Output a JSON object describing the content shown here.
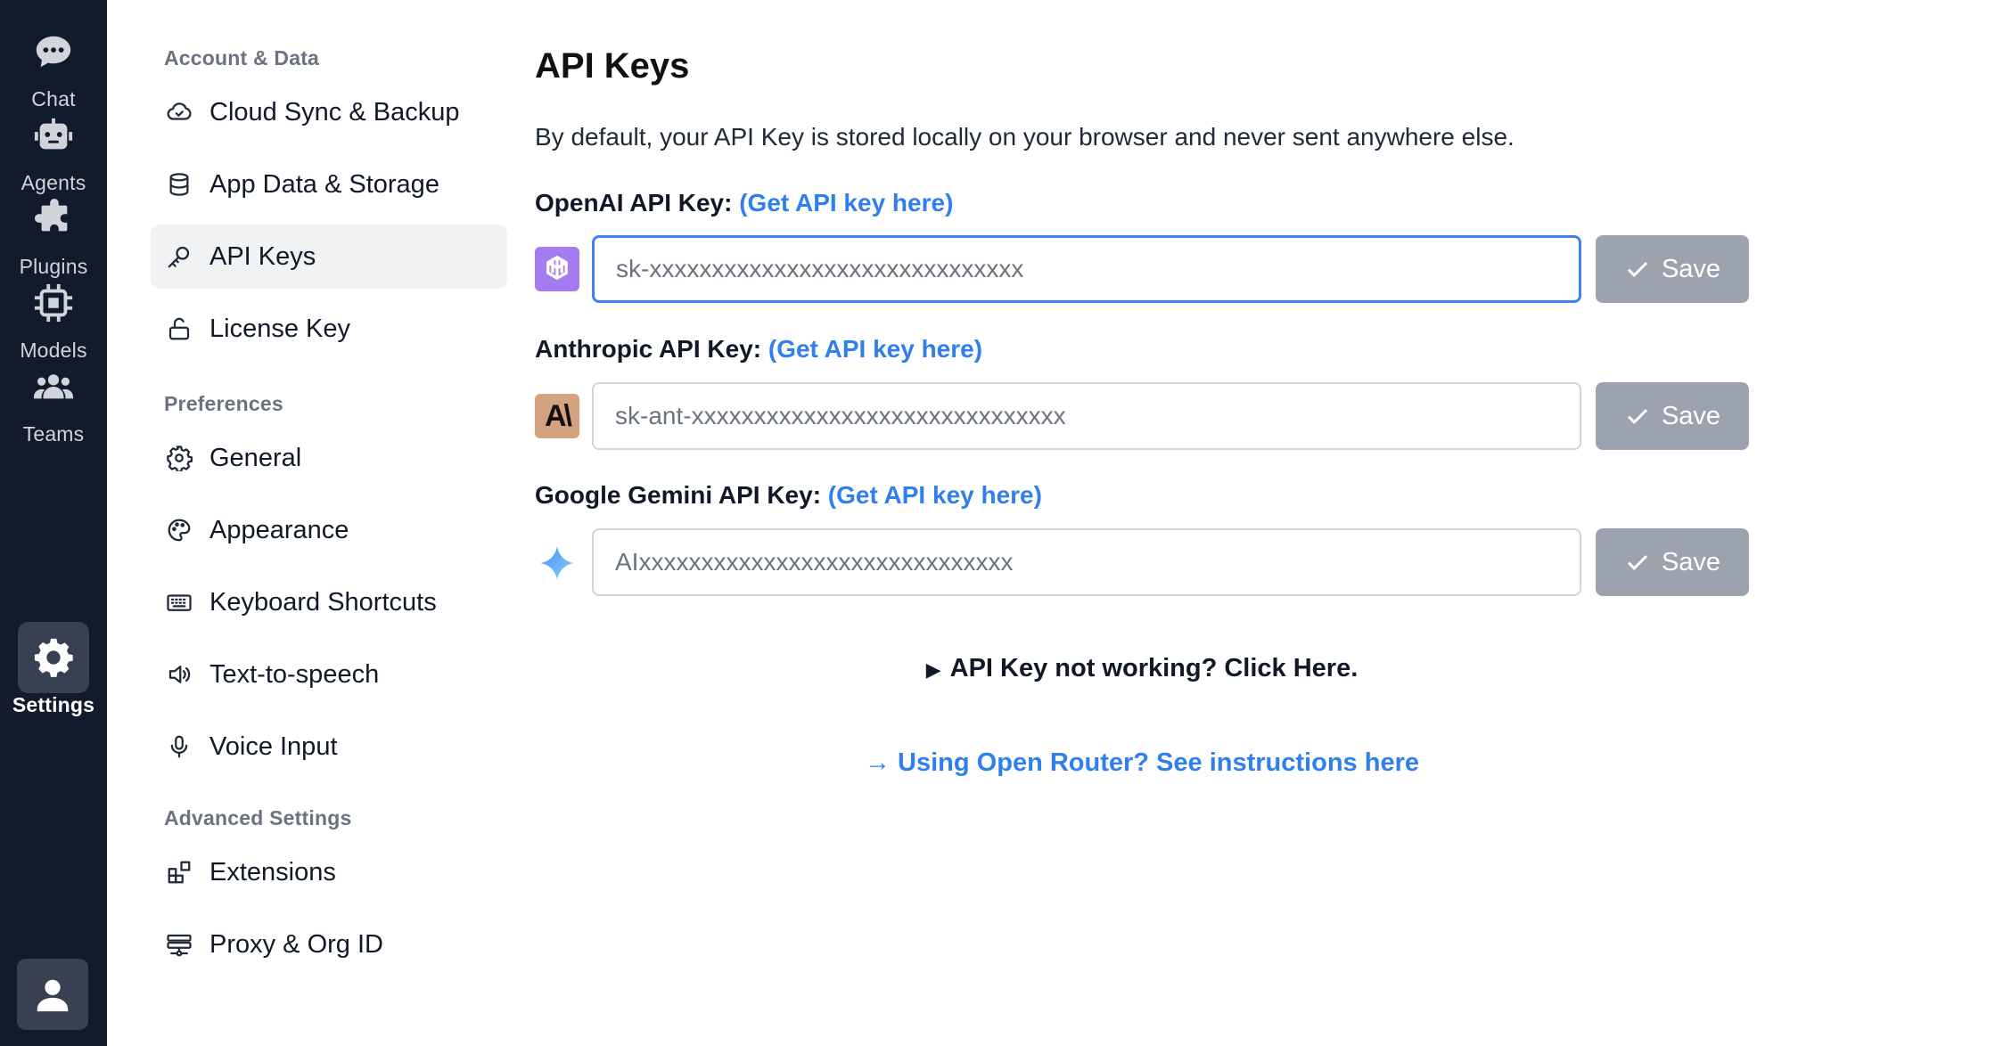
{
  "rail": {
    "items": [
      {
        "label": "Chat",
        "icon": "chat-bubble-icon"
      },
      {
        "label": "Agents",
        "icon": "robot-icon"
      },
      {
        "label": "Plugins",
        "icon": "puzzle-icon"
      },
      {
        "label": "Models",
        "icon": "chip-icon"
      },
      {
        "label": "Teams",
        "icon": "users-icon"
      },
      {
        "label": "Settings",
        "icon": "gear-icon",
        "active": true
      }
    ],
    "avatar_icon": "user-icon"
  },
  "nav": {
    "sections": [
      "Account & Data",
      "Preferences",
      "Advanced Settings"
    ],
    "items": [
      {
        "label": "Cloud Sync & Backup",
        "icon": "cloud-check-icon"
      },
      {
        "label": "App Data & Storage",
        "icon": "database-icon"
      },
      {
        "label": "API Keys",
        "icon": "key-icon",
        "active": true
      },
      {
        "label": "License Key",
        "icon": "unlock-icon"
      },
      {
        "label": "General",
        "icon": "gear-outline-icon"
      },
      {
        "label": "Appearance",
        "icon": "palette-icon"
      },
      {
        "label": "Keyboard Shortcuts",
        "icon": "keyboard-icon"
      },
      {
        "label": "Text-to-speech",
        "icon": "speaker-icon"
      },
      {
        "label": "Voice Input",
        "icon": "microphone-icon"
      },
      {
        "label": "Extensions",
        "icon": "extensions-icon"
      },
      {
        "label": "Proxy & Org ID",
        "icon": "network-icon"
      }
    ]
  },
  "main": {
    "title": "API Keys",
    "description": "By default, your API Key is stored locally on your browser and never sent anywhere else.",
    "keys": [
      {
        "label": "OpenAI API Key:",
        "link": "(Get API key here)",
        "placeholder": "sk-xxxxxxxxxxxxxxxxxxxxxxxxxxxxxx",
        "value": "",
        "save_label": "Save",
        "logo": "openai-logo-icon"
      },
      {
        "label": "Anthropic API Key:",
        "link": "(Get API key here)",
        "placeholder": "sk-ant-xxxxxxxxxxxxxxxxxxxxxxxxxxxxxx",
        "value": "",
        "save_label": "Save",
        "logo": "anthropic-logo-icon",
        "logo_text": "A\\"
      },
      {
        "label": "Google Gemini API Key:",
        "link": "(Get API key here)",
        "placeholder": "AIxxxxxxxxxxxxxxxxxxxxxxxxxxxxxx",
        "value": "",
        "save_label": "Save",
        "logo": "gemini-logo-icon"
      }
    ],
    "help_toggle": "API Key not working? Click Here.",
    "help_arrow": "▶",
    "router_link": "→ Using Open Router? See instructions here"
  },
  "colors": {
    "rail_bg": "#111b2b",
    "accent_link": "#2f80ed",
    "focus_border": "#3b82f6",
    "save_button": "#9ca3af",
    "active_nav_bg": "#f1f2f4"
  }
}
